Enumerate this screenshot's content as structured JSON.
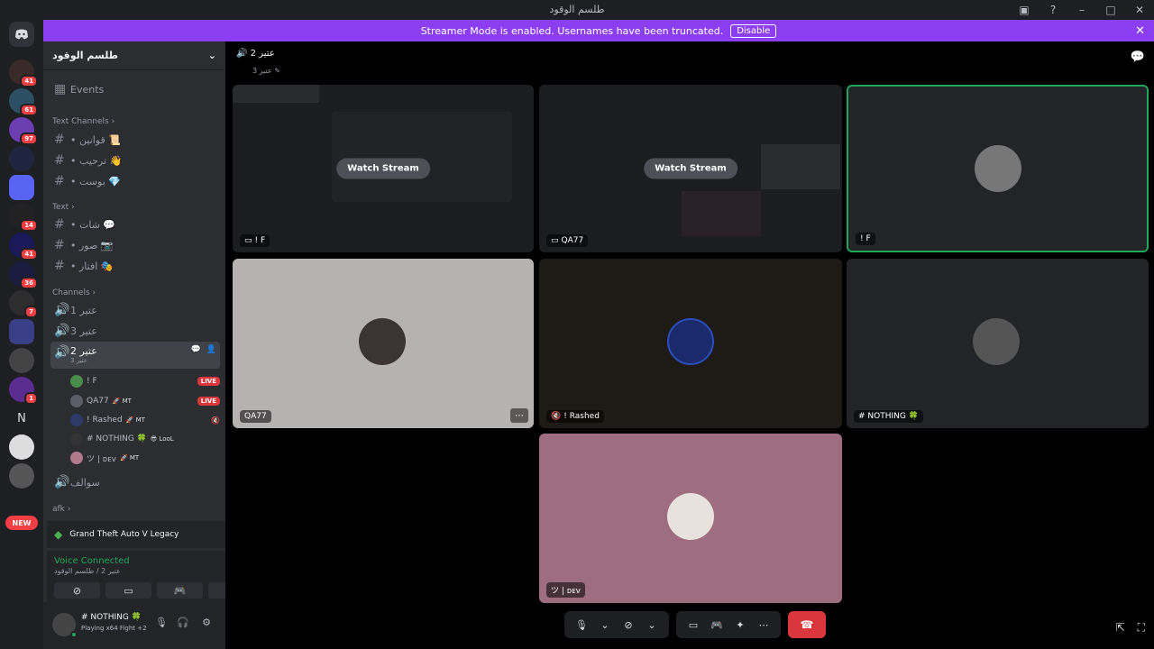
{
  "window": {
    "title": "طلسم الوقود"
  },
  "banner": {
    "text": "Streamer Mode is enabled. Usernames have been truncated.",
    "disable_label": "Disable"
  },
  "server_badges": [
    "41",
    "61",
    "97",
    "14",
    "41",
    "36",
    "7",
    "1"
  ],
  "server_letter": "N",
  "new_badge": "NEW",
  "guild": {
    "name": "طلسم الوقود"
  },
  "events_label": "Events",
  "categories": {
    "text_channels": "Text Channels",
    "text": "Text",
    "channels": "Channels",
    "afk": "afk"
  },
  "text_channels": [
    {
      "name": "• قوانين 📜"
    },
    {
      "name": "• ترحيب 👋"
    },
    {
      "name": "• بوست 💎"
    }
  ],
  "text2_channels": [
    {
      "name": "• شات 💬"
    },
    {
      "name": "• صور 📷"
    },
    {
      "name": "• افتار 🎭"
    }
  ],
  "voice_channels": [
    {
      "name": "عتير 1"
    },
    {
      "name": "عتير 3"
    },
    {
      "name": "عتير 2",
      "sub": "عتير 3"
    },
    {
      "name": "سوالف"
    }
  ],
  "members": [
    {
      "name": "! F",
      "tag": "",
      "live": "LIVE"
    },
    {
      "name": "QA77",
      "tag": "🚀 MT",
      "live": "LIVE"
    },
    {
      "name": "! Rashed",
      "tag": "🚀 MT",
      "live": ""
    },
    {
      "name": "# NOTHING 🍀",
      "tag": "😎 LooL",
      "live": ""
    },
    {
      "name": "ツ | ᴅᴇᴠ",
      "tag": "🚀 MT",
      "live": ""
    }
  ],
  "activity": {
    "game": "Grand Theft Auto V Legacy"
  },
  "voice": {
    "status": "Voice Connected",
    "location": "عتير 2 / طلسم الوقود"
  },
  "user": {
    "name": "# NOTHING 🍀",
    "status": "Playing x64 Fight +2"
  },
  "channel_header": {
    "name": "عتير 2",
    "sub": "عتير 3"
  },
  "tiles": [
    {
      "label": "! F",
      "watch": "Watch Stream",
      "kind": "stream"
    },
    {
      "label": "QA77",
      "watch": "Watch Stream",
      "kind": "stream"
    },
    {
      "label": "! F",
      "kind": "camera"
    },
    {
      "label": "QA77",
      "kind": "avatar"
    },
    {
      "label": "! Rashed",
      "kind": "avatar"
    },
    {
      "label": "# NOTHING 🍀",
      "kind": "avatar"
    },
    {
      "label": "ツ | ᴅᴇᴠ",
      "kind": "avatar"
    }
  ],
  "colors": {
    "accent": "#8c3ff2",
    "live": "#da373c",
    "connected": "#23a55a",
    "speaking": "#23a55a"
  }
}
